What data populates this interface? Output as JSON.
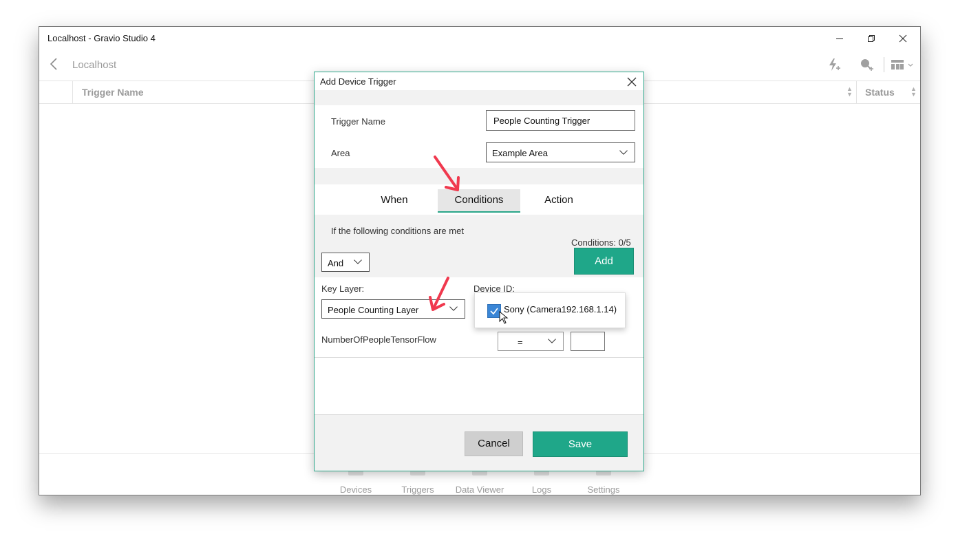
{
  "window": {
    "title": "Localhost - Gravio Studio 4",
    "controls": [
      "minimize-icon",
      "restore-icon",
      "close-icon"
    ]
  },
  "nav": {
    "back_icon": "chevron-left-icon",
    "title": "Localhost",
    "toolbar_icons": [
      "lightning-plus-icon",
      "search-plus-icon",
      "layout-grid-icon"
    ]
  },
  "table": {
    "columns": [
      "Trigger Name",
      "Status"
    ]
  },
  "bottom_nav": {
    "items": [
      "Devices",
      "Triggers",
      "Data Viewer",
      "Logs",
      "Settings"
    ]
  },
  "dialog": {
    "title": "Add Device Trigger",
    "trigger_name_label": "Trigger Name",
    "trigger_name_value": "People Counting Trigger",
    "area_label": "Area",
    "area_value": "Example Area",
    "tabs": [
      {
        "label": "When",
        "active": false
      },
      {
        "label": "Conditions",
        "active": true
      },
      {
        "label": "Action",
        "active": false
      }
    ],
    "conditions_intro": "If the following conditions are met",
    "conditions_count": "Conditions: 0/5",
    "add_label": "Add",
    "logic_value": "And",
    "key_layer_label": "Key Layer:",
    "key_layer_value": "People Counting Layer",
    "device_id_label": "Device ID:",
    "device_option": "Sony (Camera192.168.1.14)",
    "device_option_checked": true,
    "property_label": "NumberOfPeopleTensorFlow",
    "operator_value": "=",
    "compare_value": "",
    "cancel_label": "Cancel",
    "save_label": "Save"
  },
  "colors": {
    "accent": "#1fa789",
    "annotation_arrow": "#f0394e",
    "checkbox": "#3a86d6"
  }
}
